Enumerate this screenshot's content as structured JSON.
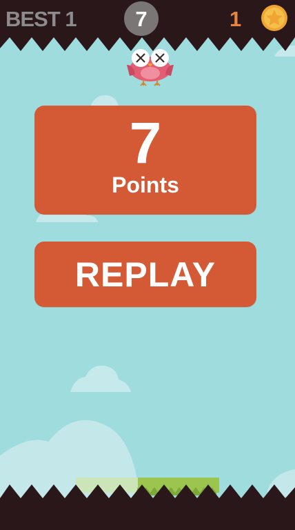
{
  "hud": {
    "best_label": "BEST",
    "best_value": "1",
    "current_score": "7",
    "coin_count": "1",
    "coin_icon": "star-coin-icon"
  },
  "result_panel": {
    "score": "7",
    "label": "Points"
  },
  "replay_button": {
    "label": "REPLAY"
  },
  "character": {
    "icon": "owl-dead-icon"
  },
  "colors": {
    "sky": "#9edcdd",
    "panel": "#d45a35",
    "spikes": "#2a1719",
    "grass": "#9bc54f",
    "coin": "#f0a431",
    "best_text": "#8c8c8c",
    "coin_text": "#e8843f"
  }
}
